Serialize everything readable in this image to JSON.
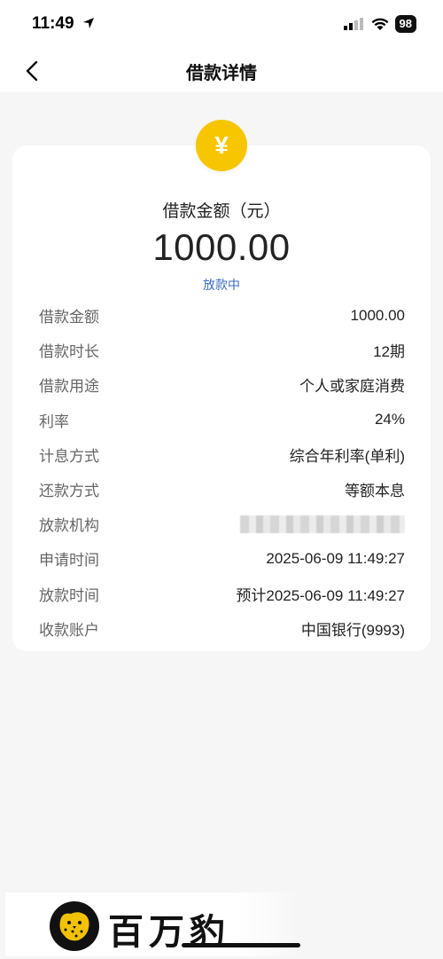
{
  "status_bar": {
    "time": "11:49",
    "battery": "98"
  },
  "nav": {
    "title": "借款详情",
    "back_icon": "chevron-left-icon"
  },
  "summary": {
    "amount_label": "借款金额（元）",
    "amount": "1000.00",
    "status": "放款中",
    "coin_symbol": "¥"
  },
  "details": [
    {
      "label": "借款金额",
      "value": "1000.00"
    },
    {
      "label": "借款时长",
      "value": "12期"
    },
    {
      "label": "借款用途",
      "value": "个人或家庭消费"
    },
    {
      "label": "利率",
      "value": "24%"
    },
    {
      "label": "计息方式",
      "value": "综合年利率(单利)"
    },
    {
      "label": "还款方式",
      "value": "等额本息"
    },
    {
      "label": "放款机构",
      "value": ""
    },
    {
      "label": "申请时间",
      "value": "2025-06-09 11:49:27"
    },
    {
      "label": "放款时间",
      "value": "预计2025-06-09 11:49:27"
    },
    {
      "label": "收款账户",
      "value": "中国银行(9993)"
    }
  ],
  "footer": {
    "brand": "百万豹"
  },
  "colors": {
    "accent_yellow": "#f7c600",
    "status_blue": "#3b6cc6",
    "background": "#f6f6f6"
  }
}
